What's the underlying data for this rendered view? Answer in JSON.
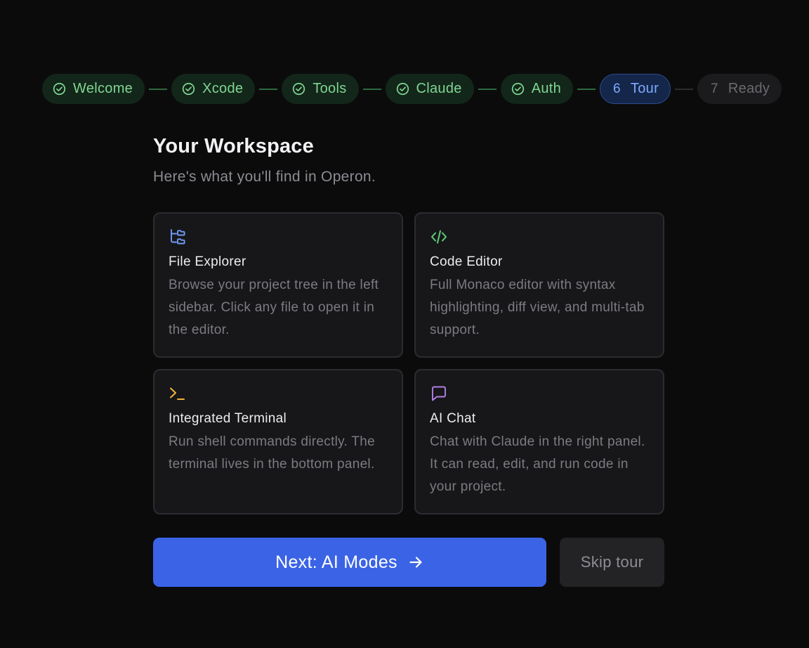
{
  "stepper": {
    "steps": [
      {
        "label": "Welcome",
        "state": "done",
        "icon": "check-circle-icon"
      },
      {
        "label": "Xcode",
        "state": "done",
        "icon": "check-circle-icon"
      },
      {
        "label": "Tools",
        "state": "done",
        "icon": "check-circle-icon"
      },
      {
        "label": "Claude",
        "state": "done",
        "icon": "check-circle-icon"
      },
      {
        "label": "Auth",
        "state": "done",
        "icon": "check-circle-icon"
      },
      {
        "label": "Tour",
        "state": "active",
        "number": "6"
      },
      {
        "label": "Ready",
        "state": "pending",
        "number": "7"
      }
    ]
  },
  "header": {
    "title": "Your Workspace",
    "subtitle": "Here's what you'll find in Operon."
  },
  "features": [
    {
      "title": "File Explorer",
      "description": "Browse your project tree in the left sidebar. Click any file to open it in the editor.",
      "icon": "folder-tree-icon",
      "color": "#6f9bf5"
    },
    {
      "title": "Code Editor",
      "description": "Full Monaco editor with syntax highlighting, diff view, and multi-tab support.",
      "icon": "code-icon",
      "color": "#5fcf77"
    },
    {
      "title": "Integrated Terminal",
      "description": "Run shell commands directly. The terminal lives in the bottom panel.",
      "icon": "terminal-icon",
      "color": "#f0b43c"
    },
    {
      "title": "AI Chat",
      "description": "Chat with Claude in the right panel. It can read, edit, and run code in your project.",
      "icon": "chat-bubble-icon",
      "color": "#b07fe6"
    }
  ],
  "actions": {
    "next_label": "Next: AI Modes",
    "next_icon": "arrow-right-icon",
    "skip_label": "Skip tour"
  },
  "colors": {
    "accent": "#3a63e6",
    "done": "#7fd693",
    "active": "#7ea9ff",
    "background": "#0b0b0c"
  }
}
